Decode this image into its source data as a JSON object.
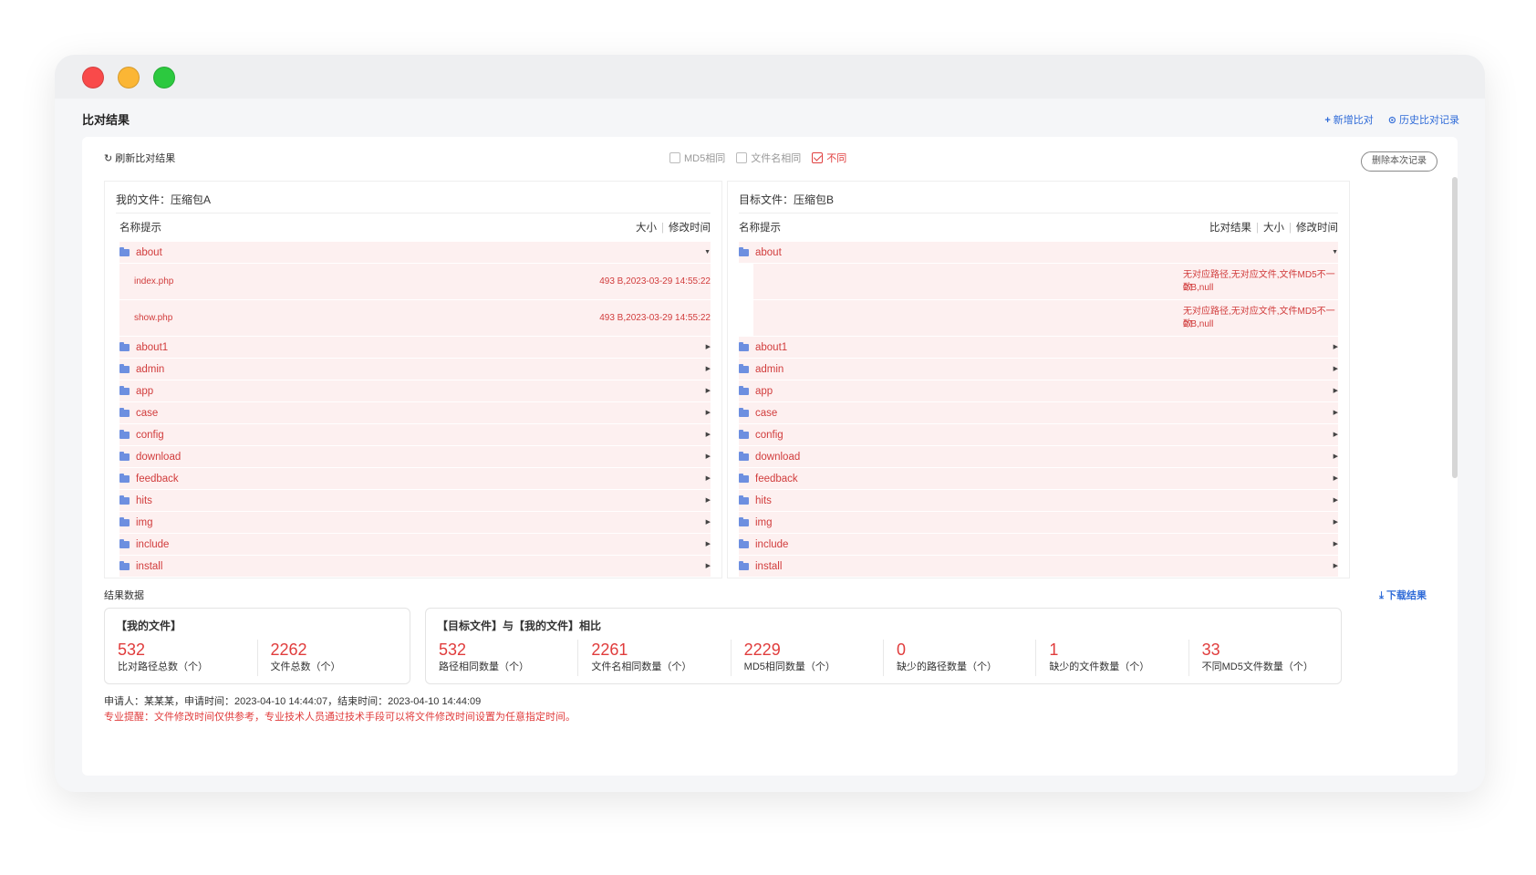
{
  "page": {
    "title": "比对结果"
  },
  "header": {
    "add_compare": "新增比对",
    "history": "历史比对记录"
  },
  "toolbar": {
    "refresh": "刷新比对结果",
    "filters": [
      {
        "label": "MD5相同",
        "checked": false
      },
      {
        "label": "文件名相同",
        "checked": false
      },
      {
        "label": "不同",
        "checked": true
      }
    ],
    "delete_label": "删除本次记录"
  },
  "left_panel": {
    "title": "我的文件：压缩包A",
    "col_name": "名称提示",
    "col_size": "大小",
    "col_time": "修改时间",
    "expanded_folder": "about",
    "files": [
      {
        "name": "index.php",
        "meta": "493 B,2023-03-29 14:55:22"
      },
      {
        "name": "show.php",
        "meta": "493 B,2023-03-29 14:55:22"
      }
    ],
    "folders": [
      "about1",
      "admin",
      "app",
      "case",
      "config",
      "download",
      "feedback",
      "hits",
      "img",
      "include",
      "install"
    ]
  },
  "right_panel": {
    "title": "目标文件：压缩包B",
    "col_name": "名称提示",
    "col_result": "比对结果",
    "col_size": "大小",
    "col_time": "修改时间",
    "expanded_folder": "about",
    "files": [
      {
        "result": "无对应路径,无对应文件,文件MD5不一致",
        "meta": "0 B,null"
      },
      {
        "result": "无对应路径,无对应文件,文件MD5不一致",
        "meta": "0 B,null"
      }
    ],
    "folders": [
      "about1",
      "admin",
      "app",
      "case",
      "config",
      "download",
      "feedback",
      "hits",
      "img",
      "include",
      "install"
    ]
  },
  "results": {
    "heading": "结果数据",
    "download": "下载结果",
    "my_files": {
      "title": "【我的文件】",
      "stats": [
        {
          "value": "532",
          "label": "比对路径总数（个）"
        },
        {
          "value": "2262",
          "label": "文件总数（个）"
        }
      ]
    },
    "compare": {
      "title": "【目标文件】与【我的文件】相比",
      "stats": [
        {
          "value": "532",
          "label": "路径相同数量（个）"
        },
        {
          "value": "2261",
          "label": "文件名相同数量（个）"
        },
        {
          "value": "2229",
          "label": "MD5相同数量（个）"
        },
        {
          "value": "0",
          "label": "缺少的路径数量（个）"
        },
        {
          "value": "1",
          "label": "缺少的文件数量（个）"
        },
        {
          "value": "33",
          "label": "不同MD5文件数量（个）"
        }
      ]
    }
  },
  "footer": {
    "applicant": "申请人：某某某，申请时间：2023-04-10 14:44:07，结束时间：2023-04-10 14:44:09",
    "warning": "专业提醒：文件修改时间仅供参考，专业技术人员通过技术手段可以将文件修改时间设置为任意指定时间。"
  },
  "colors": {
    "accent": "#2f6bd8",
    "danger": "#e03c3c",
    "row_bg": "#fdf0f0",
    "folder": "#6d8fe0"
  }
}
